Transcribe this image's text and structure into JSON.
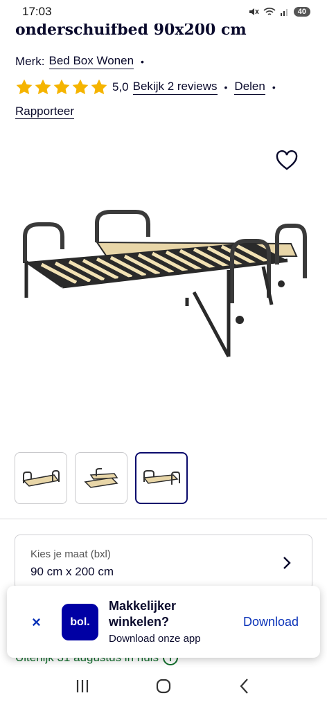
{
  "status_bar": {
    "time": "17:03",
    "battery": "40"
  },
  "product": {
    "title": "onderschuifbed 90x200 cm",
    "brand_label": "Merk:",
    "brand": "Bed Box Wonen",
    "rating": "5,0",
    "reviews_link": "Bekijk 2 reviews",
    "share_link": "Delen",
    "report_link": "Rapporteer",
    "separator": "•"
  },
  "gallery": {
    "thumbnail_count": 3,
    "active_index": 2
  },
  "size_selector": {
    "label": "Kies je maat (bxl)",
    "value": "90 cm x 200 cm"
  },
  "delivery": {
    "text": "Uiterlijk 31 augustus in huis"
  },
  "app_banner": {
    "title": "Makkelijker winkelen?",
    "subtitle": "Download onze app",
    "download_label": "Download",
    "logo_text": "bol.",
    "close_symbol": "×"
  },
  "colors": {
    "text": "#0a0a2c",
    "brand_blue": "#0000a4",
    "link_blue": "#0a32b8",
    "star": "#f5b400",
    "delivery_green": "#116e2c"
  },
  "icons": [
    "heart-icon",
    "star-icon",
    "chevron-right-icon",
    "close-icon",
    "recent-apps-icon",
    "home-icon",
    "back-icon"
  ]
}
